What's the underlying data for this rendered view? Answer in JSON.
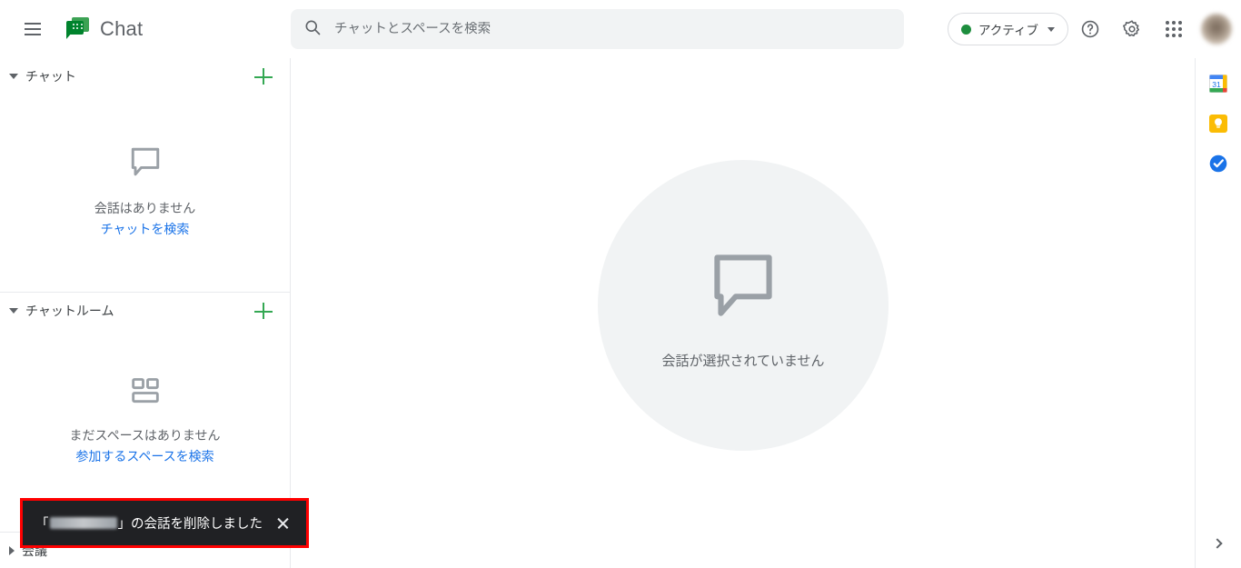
{
  "header": {
    "menu_icon": "hamburger-menu-icon",
    "logo_icon": "google-chat-logo-icon",
    "title": "Chat",
    "search": {
      "icon": "search-icon",
      "placeholder": "チャットとスペースを検索",
      "value": ""
    },
    "status": {
      "label": "アクティブ",
      "dot_color": "#1e8e3e",
      "caret_icon": "chevron-down-icon"
    },
    "help_icon": "help-circle-icon",
    "settings_icon": "gear-icon",
    "apps_icon": "apps-grid-icon",
    "avatar_icon": "user-avatar"
  },
  "sidebar": {
    "chat_section": {
      "toggle_icon": "triangle-down-icon",
      "title": "チャット",
      "add_icon": "plus-icon",
      "empty_icon": "speech-bubble-icon",
      "empty_text": "会話はありません",
      "empty_link": "チャットを検索"
    },
    "spaces_section": {
      "toggle_icon": "triangle-down-icon",
      "title": "チャットルーム",
      "add_icon": "plus-icon",
      "empty_icon": "spaces-grid-icon",
      "empty_text": "まだスペースはありません",
      "empty_link": "参加するスペースを検索"
    },
    "meet_section": {
      "toggle_icon": "triangle-right-icon",
      "title": "会議"
    }
  },
  "main": {
    "empty_icon": "speech-bubble-icon",
    "empty_text": "会話が選択されていません"
  },
  "right_rail": {
    "items": [
      {
        "name": "google-calendar-icon",
        "label": "カレンダー"
      },
      {
        "name": "google-keep-icon",
        "label": "Keep"
      },
      {
        "name": "google-tasks-icon",
        "label": "ToDo リスト"
      }
    ],
    "expand_icon": "chevron-right-icon"
  },
  "toast": {
    "text_prefix": "「",
    "redacted_name": "",
    "text_suffix": "」の会話を削除しました",
    "close_icon": "close-icon",
    "highlight_color": "#ff0000",
    "background_color": "#202124"
  }
}
